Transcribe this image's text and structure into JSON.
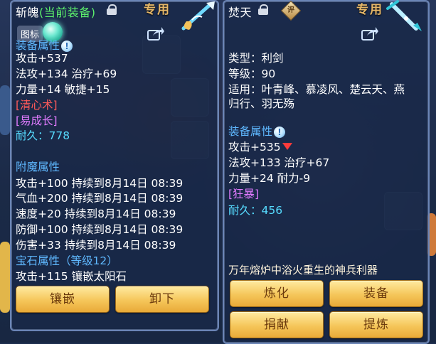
{
  "left_panel": {
    "item_name": "斩魄",
    "equipped_tag": "(当前装备)",
    "special_tag": "专用",
    "icon_chip": "图标",
    "stats_section_title": "装备属性",
    "stats": [
      "攻击+537",
      "法攻+134 治疗+69",
      "力量+14 敏捷+15"
    ],
    "skills": [
      "[清心术]",
      "[易成长]"
    ],
    "durability": "耐久：778",
    "enchant_section_title": "附魔属性",
    "enchants": [
      "攻击+100 持续到8月14日 08:39",
      "气血+200 持续到8月14日 08:39",
      "速度+20 持续到8月14日 08:39",
      "防御+100 持续到8月14日 08:39",
      "伤害+33 持续到8月14日 08:39"
    ],
    "gem_section_title": "宝石属性（等级12）",
    "gem_line": "攻击+115 镶嵌太阳石",
    "buttons": {
      "inlay": "镶嵌",
      "unequip": "卸下"
    }
  },
  "right_panel": {
    "item_name": "焚天",
    "rating_badge": "评",
    "special_tag": "专用",
    "type_line": "类型：利剑",
    "level_line": "等级：90",
    "suits_line_1": "适用：叶青峰、慕凌风、楚云天、燕",
    "suits_line_2": "归行、羽无殇",
    "stats_section_title": "装备属性",
    "stats": [
      "攻击+535",
      "法攻+133 治疗+67",
      "力量+24 耐力-9"
    ],
    "skill": "[狂暴]",
    "durability": "耐久：456",
    "description": "万年熔炉中浴火重生的神兵利器",
    "buttons": {
      "refine": "炼化",
      "equip": "装备",
      "donate": "捐献",
      "extract": "提炼"
    }
  },
  "colors": {
    "section": "#5fb8ff",
    "equipped": "#5cf06c",
    "skill_red": "#ff5a5a",
    "skill_purple": "#e07bff",
    "durability": "#57dcff",
    "button_gold": "#f5c65a"
  }
}
